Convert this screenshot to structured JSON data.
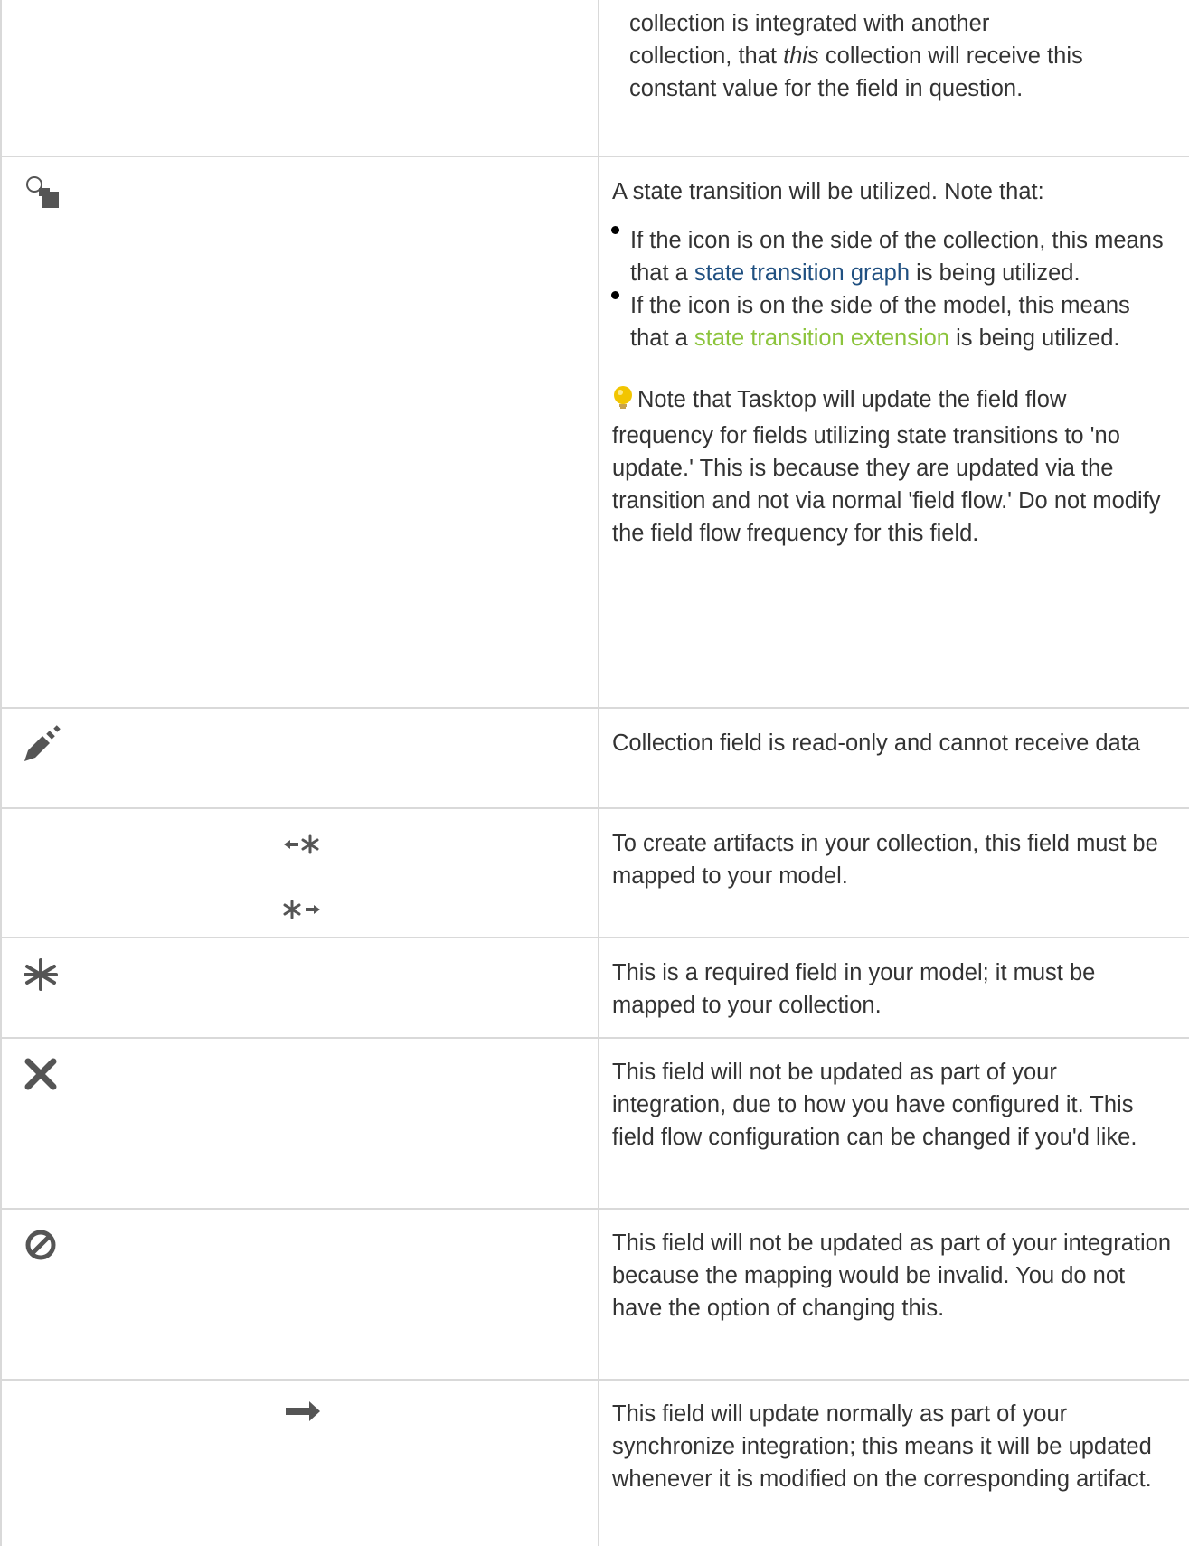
{
  "rows": {
    "constant": {
      "line1": "collection is integrated with another",
      "line2_pre": "collection, that ",
      "line2_em": "this",
      "line2_post": " collection will receive this",
      "line3": "constant value for the field in question."
    },
    "state_transition": {
      "icon": "state-transition-icon",
      "intro": "A state transition will be utilized. Note that:",
      "bullets": [
        {
          "pre": "If the icon is on the side of the collection, this means that a ",
          "link": "state transition graph",
          "post": " is being utilized."
        },
        {
          "pre": "If the icon is on the side of the model, this means that a ",
          "link": "state transition extension",
          "post": " is being utilized."
        }
      ],
      "note_icon": "lightbulb-icon",
      "note": "Note that Tasktop will update the field flow frequency for fields utilizing state transitions to 'no update.' This is because they are updated via the transition and not via normal 'field flow.' Do not modify the field flow frequency for this field."
    },
    "read_only": {
      "icon": "pencil-slash-icon",
      "text": "Collection field is read-only and cannot receive data"
    },
    "create_artifacts": {
      "icon_top": "arrow-left-asterisk-icon",
      "icon_bottom": "asterisk-arrow-right-icon",
      "text": "To create artifacts in your collection, this field must be mapped to your model."
    },
    "required": {
      "icon": "asterisk-icon",
      "text": "This is a required field in your model; it must be mapped to your collection."
    },
    "not_updated_config": {
      "icon": "x-icon",
      "text": "This field will not be updated as part of your integration, due to how you have configured it. This field flow configuration can be changed if you'd like."
    },
    "not_updated_invalid": {
      "icon": "prohibited-icon",
      "text": "This field will not be updated as part of your integration because the mapping would be invalid. You do not have the option of changing this."
    },
    "update_normally": {
      "icon": "arrow-right-icon",
      "text": "This field will update normally as part of your synchronize integration; this means it will be updated whenever it is modified on the corresponding artifact."
    }
  },
  "colors": {
    "text": "#333333",
    "icon": "#555555",
    "border": "#d9d9d9",
    "link_blue": "#205081",
    "link_green": "#8cc43c",
    "bulb": "#f2c500"
  }
}
